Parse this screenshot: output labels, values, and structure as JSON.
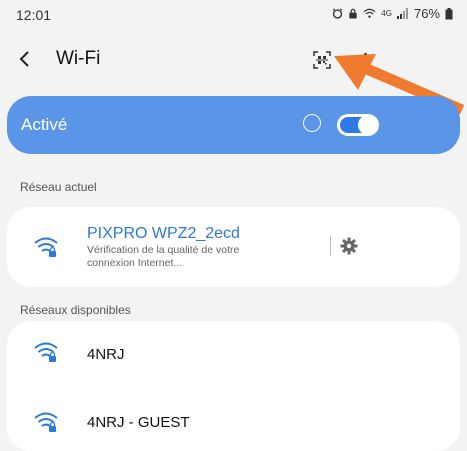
{
  "status_bar": {
    "time": "12:01",
    "network_type": "4G",
    "battery": "76%"
  },
  "header": {
    "title": "Wi-Fi"
  },
  "wifi_toggle": {
    "label": "Activé",
    "enabled": true
  },
  "current_network": {
    "section_label": "Réseau actuel",
    "name": "PIXPRO WPZ2_2ecd",
    "status": "Vérification de la qualité de votre connexion Internet..."
  },
  "available_networks": {
    "section_label": "Réseaux disponibles",
    "items": [
      {
        "name": "4NRJ"
      },
      {
        "name": "4NRJ - GUEST"
      }
    ]
  },
  "colors": {
    "accent": "#5a95e8",
    "link": "#2a78d8",
    "arrow": "#f07a2e"
  }
}
